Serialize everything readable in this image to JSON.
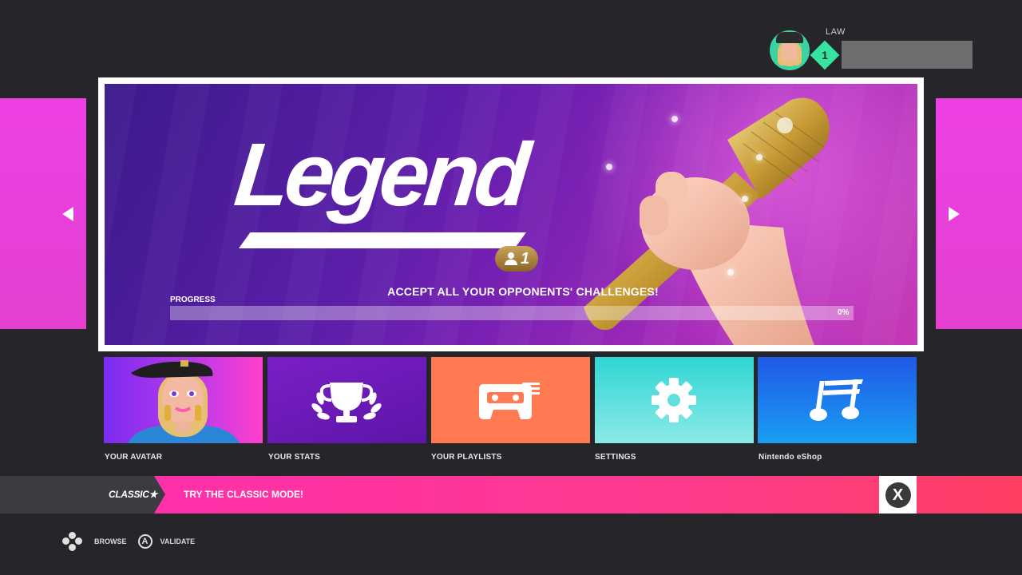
{
  "profile": {
    "name": "LAW",
    "level": "1"
  },
  "banner": {
    "title": "Legend",
    "players": "1",
    "challenge": "ACCEPT ALL YOUR OPPONENTS' CHALLENGES!",
    "progress_label": "PROGRESS",
    "progress_percent": "0%",
    "progress_value": 0
  },
  "tiles": [
    {
      "label": "YOUR AVATAR",
      "icon": "avatar-portrait"
    },
    {
      "label": "YOUR STATS",
      "icon": "trophy-icon"
    },
    {
      "label": "YOUR PLAYLISTS",
      "icon": "cassette-playlist-icon"
    },
    {
      "label": "SETTINGS",
      "icon": "gear-icon"
    },
    {
      "label": "Nintendo eShop",
      "icon": "music-note-icon"
    }
  ],
  "classic": {
    "tag": "CLASSIC★",
    "message": "TRY THE CLASSIC MODE!",
    "close": "X"
  },
  "hints": [
    {
      "icon": "dpad-icon",
      "label": "BROWSE"
    },
    {
      "icon": "a-button-icon",
      "button": "A",
      "label": "VALIDATE"
    }
  ],
  "colors": {
    "accent_pink": "#ee3fe4",
    "level_green": "#37e3a0",
    "banner_purple": "#5a1ea8"
  }
}
